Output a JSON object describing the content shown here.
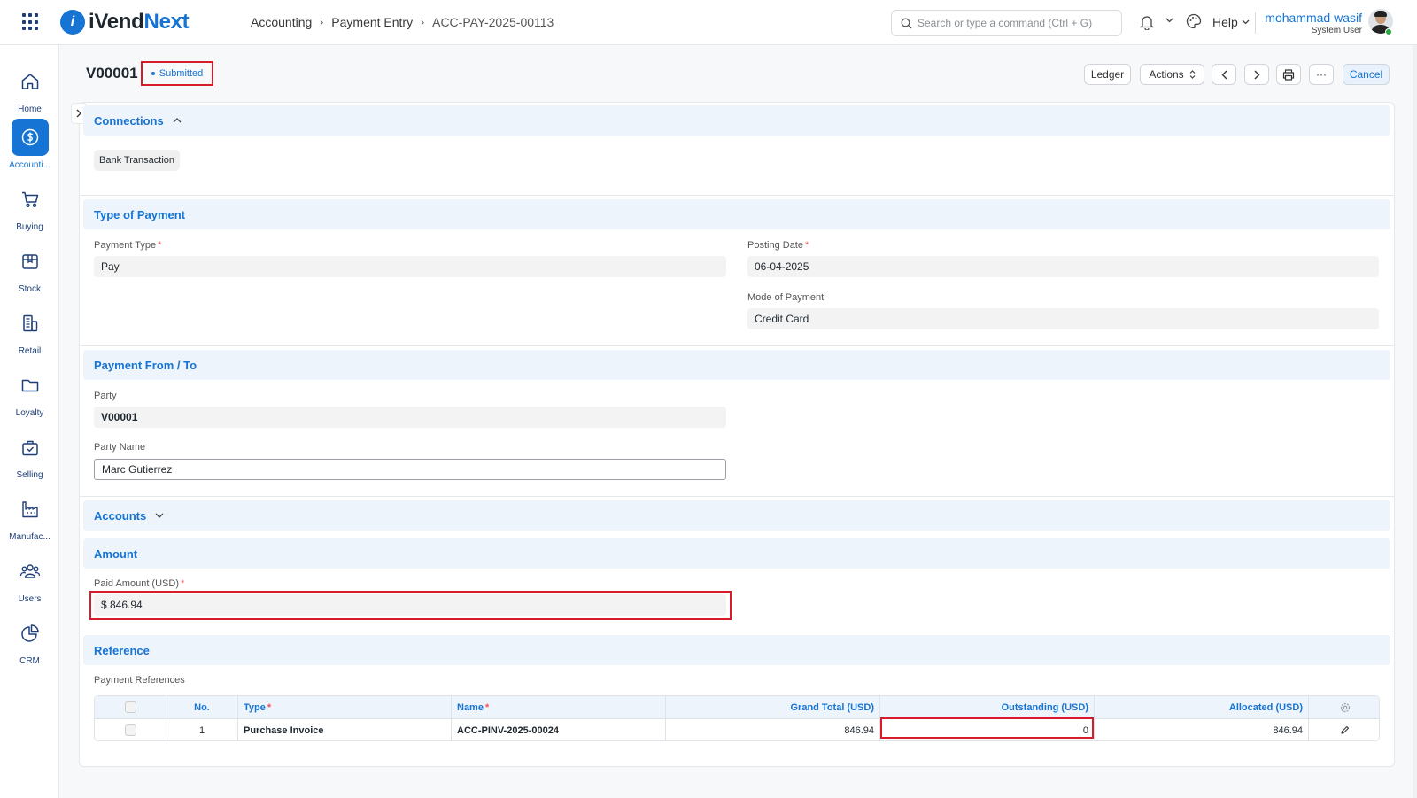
{
  "topbar": {
    "logo_part1": "iVend",
    "logo_part2": "Next",
    "breadcrumb": [
      "Accounting",
      "Payment Entry",
      "ACC-PAY-2025-00113"
    ],
    "search_placeholder": "Search or type a command (Ctrl + G)",
    "help_label": "Help",
    "user_name": "mohammad wasif",
    "user_role": "System User"
  },
  "sidebar": {
    "items": [
      {
        "label": "Home",
        "icon": "home-icon"
      },
      {
        "label": "Accounti...",
        "icon": "dollar-icon"
      },
      {
        "label": "Buying",
        "icon": "cart-icon"
      },
      {
        "label": "Stock",
        "icon": "box-icon"
      },
      {
        "label": "Retail",
        "icon": "pos-icon"
      },
      {
        "label": "Loyalty",
        "icon": "folder-icon"
      },
      {
        "label": "Selling",
        "icon": "bag-icon"
      },
      {
        "label": "Manufac...",
        "icon": "factory-icon"
      },
      {
        "label": "Users",
        "icon": "users-icon"
      },
      {
        "label": "CRM",
        "icon": "pie-icon"
      }
    ],
    "active": "Accounti..."
  },
  "header": {
    "title": "V00001",
    "status": "Submitted",
    "buttons": {
      "ledger": "Ledger",
      "actions": "Actions",
      "cancel": "Cancel",
      "more": "···"
    }
  },
  "sections": {
    "connections": {
      "title": "Connections",
      "chip": "Bank Transaction"
    },
    "type_of_payment": {
      "title": "Type of Payment",
      "payment_type_label": "Payment Type",
      "payment_type": "Pay",
      "posting_date_label": "Posting Date",
      "posting_date": "06-04-2025",
      "mode_label": "Mode of Payment",
      "mode": "Credit Card"
    },
    "payment_from_to": {
      "title": "Payment From / To",
      "party_label": "Party",
      "party": "V00001",
      "party_name_label": "Party Name",
      "party_name": "Marc Gutierrez"
    },
    "accounts": {
      "title": "Accounts"
    },
    "amount": {
      "title": "Amount",
      "paid_label": "Paid Amount (USD)",
      "paid": "$ 846.94"
    },
    "reference": {
      "title": "Reference",
      "table_label": "Payment References",
      "columns": {
        "no": "No.",
        "type": "Type",
        "name": "Name",
        "grand_total": "Grand Total (USD)",
        "outstanding": "Outstanding (USD)",
        "allocated": "Allocated (USD)"
      },
      "rows": [
        {
          "no": "1",
          "type": "Purchase Invoice",
          "name": "ACC-PINV-2025-00024",
          "grand_total": "846.94",
          "outstanding": "0",
          "allocated": "846.94"
        }
      ]
    }
  },
  "colors": {
    "accent": "#1574d4",
    "highlight": "#d61c2a",
    "section_bg": "#edf4fc"
  }
}
